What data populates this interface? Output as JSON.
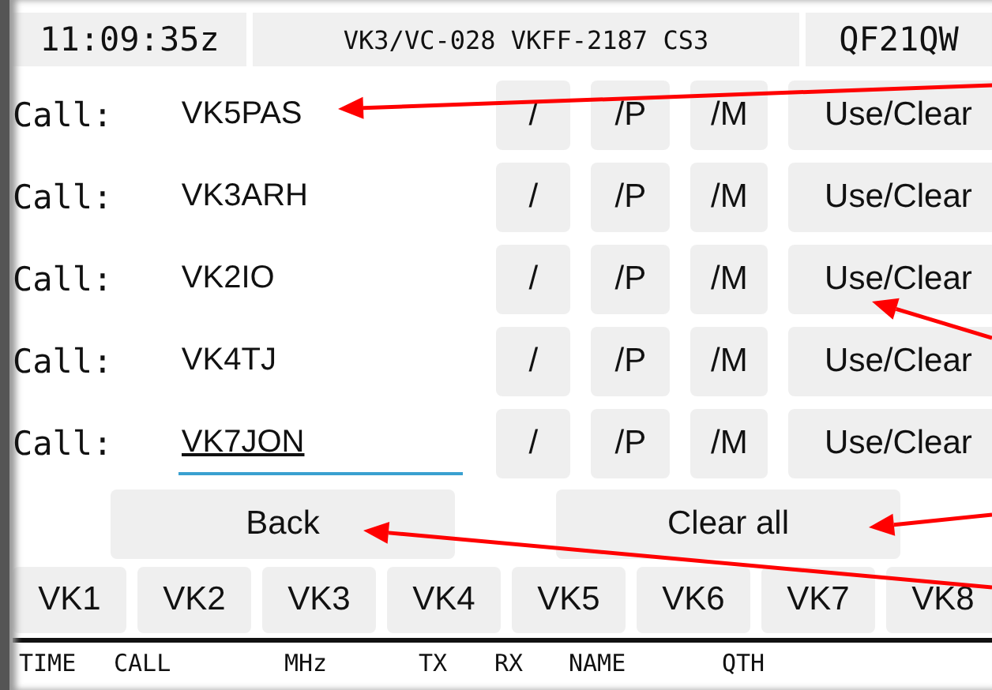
{
  "header": {
    "time": "11:09:35z",
    "reference": "VK3/VC-028 VKFF-2187 CS3",
    "locator": "QF21QW"
  },
  "calls": [
    {
      "label": "Call:",
      "value": "VK5PAS",
      "focused": false,
      "buttons": [
        "/",
        "/P",
        "/M",
        "Use/Clear"
      ]
    },
    {
      "label": "Call:",
      "value": "VK3ARH",
      "focused": false,
      "buttons": [
        "/",
        "/P",
        "/M",
        "Use/Clear"
      ]
    },
    {
      "label": "Call:",
      "value": "VK2IO",
      "focused": false,
      "buttons": [
        "/",
        "/P",
        "/M",
        "Use/Clear"
      ]
    },
    {
      "label": "Call:",
      "value": "VK4TJ",
      "focused": false,
      "buttons": [
        "/",
        "/P",
        "/M",
        "Use/Clear"
      ]
    },
    {
      "label": "Call:",
      "value": "VK7JON",
      "focused": true,
      "buttons": [
        "/",
        "/P",
        "/M",
        "Use/Clear"
      ]
    }
  ],
  "actions": [
    "Back",
    "Clear all"
  ],
  "prefixes": [
    "VK1",
    "VK2",
    "VK3",
    "VK4",
    "VK5",
    "VK6",
    "VK7",
    "VK8"
  ],
  "log_columns": [
    "TIME",
    "CALL",
    "MHz",
    "TX",
    "RX",
    "NAME",
    "QTH"
  ]
}
